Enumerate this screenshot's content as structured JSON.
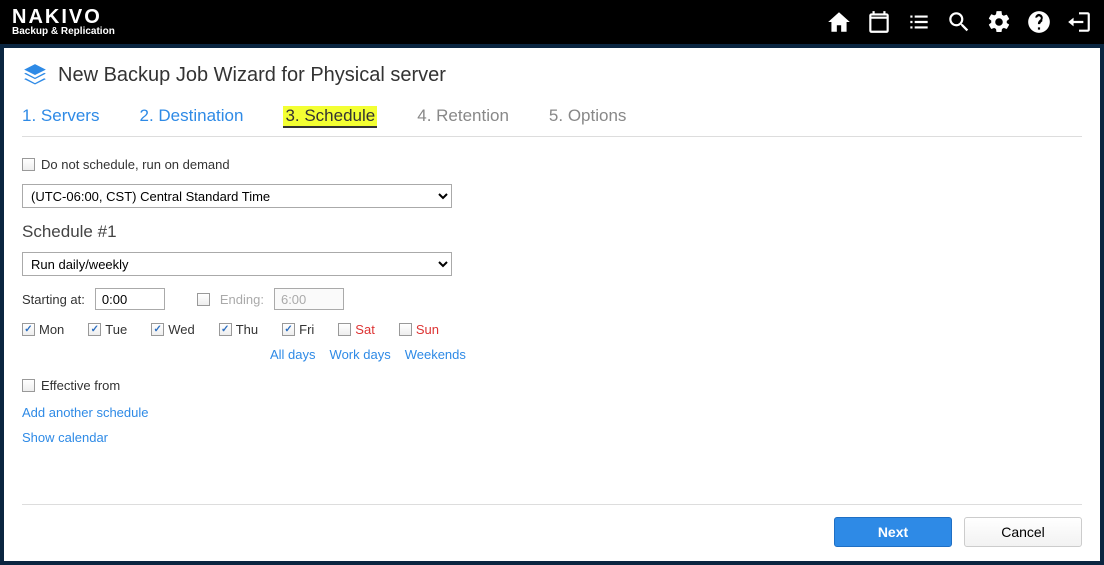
{
  "brand": {
    "name": "NAKIVO",
    "tagline": "Backup & Replication"
  },
  "page": {
    "title": "New Backup Job Wizard for Physical server"
  },
  "steps": {
    "s1": "1. Servers",
    "s2": "2. Destination",
    "s3": "3. Schedule",
    "s4": "4. Retention",
    "s5": "5. Options"
  },
  "schedule": {
    "noschedule_label": "Do not schedule, run on demand",
    "timezone": "(UTC-06:00, CST) Central Standard Time",
    "section": "Schedule #1",
    "recurrence": "Run daily/weekly",
    "starting_label": "Starting at:",
    "starting_value": "0:00",
    "ending_label": "Ending:",
    "ending_value": "6:00",
    "days": {
      "mon": "Mon",
      "tue": "Tue",
      "wed": "Wed",
      "thu": "Thu",
      "fri": "Fri",
      "sat": "Sat",
      "sun": "Sun"
    },
    "presets": {
      "all": "All days",
      "work": "Work days",
      "weekends": "Weekends"
    },
    "effective_label": "Effective from",
    "add_link": "Add another schedule",
    "calendar_link": "Show calendar"
  },
  "buttons": {
    "next": "Next",
    "cancel": "Cancel"
  }
}
